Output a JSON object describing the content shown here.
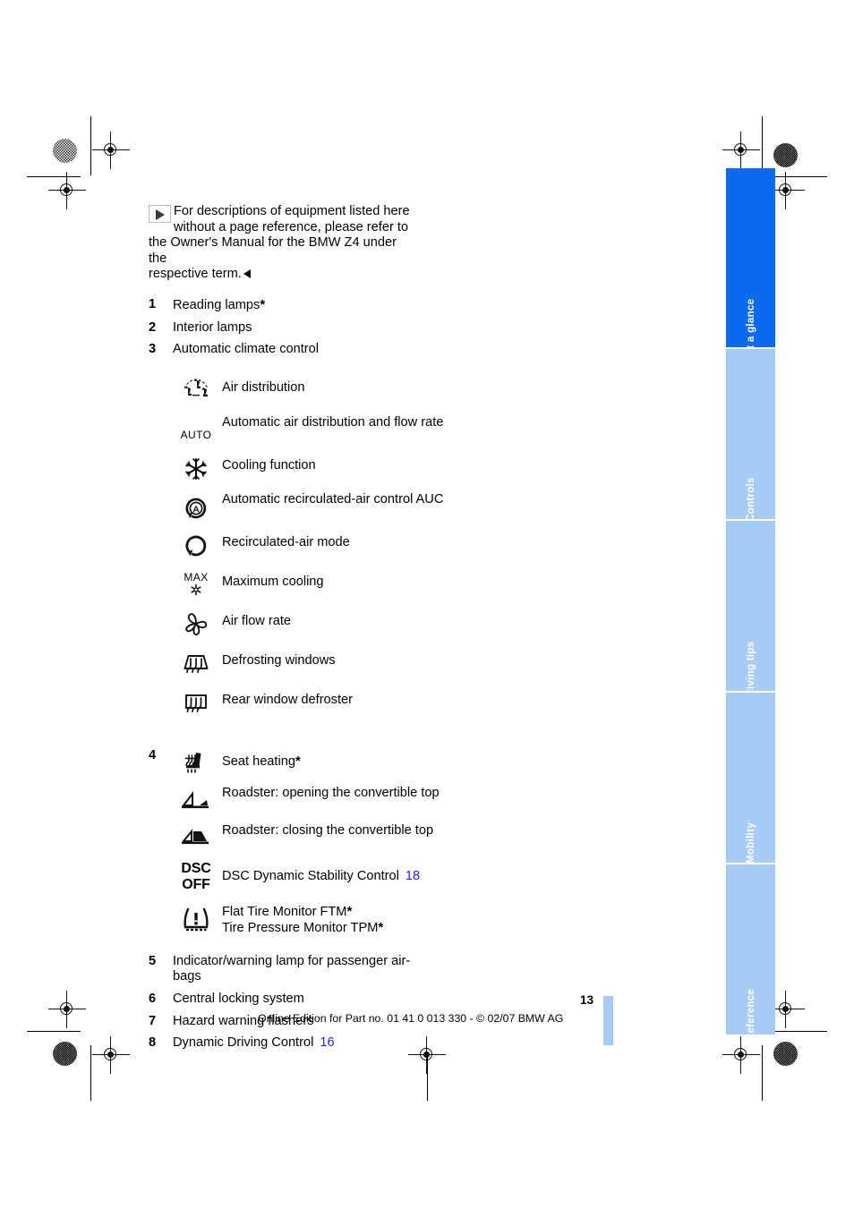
{
  "document": {
    "page_number": "13",
    "footer": "Online Edition for Part no. 01 41 0 013 330 - © 02/07 BMW AG"
  },
  "note": {
    "line1": "For descriptions of equipment listed here",
    "line2": "without a page reference, please refer to",
    "line3": "the Owner's Manual for the BMW Z4 under the",
    "line4": "respective term."
  },
  "items": [
    {
      "num": "1",
      "label": "Reading lamps",
      "star": "*"
    },
    {
      "num": "2",
      "label": "Interior lamps",
      "star": ""
    },
    {
      "num": "3",
      "label": "Automatic climate control",
      "star": ""
    }
  ],
  "climate_icons": [
    {
      "icon": "air-distribution-icon",
      "label": "Air distribution"
    },
    {
      "icon": "auto-icon",
      "label": "Automatic air distribution and flow rate"
    },
    {
      "icon": "snowflake-icon",
      "label": "Cooling function"
    },
    {
      "icon": "auc-icon",
      "label": "Automatic recirculated-air control AUC"
    },
    {
      "icon": "recirculation-icon",
      "label": "Recirculated-air mode"
    },
    {
      "icon": "max-cooling-icon",
      "label": "Maximum cooling"
    },
    {
      "icon": "fan-icon",
      "label": "Air flow rate"
    },
    {
      "icon": "windshield-defrost-icon",
      "label": "Defrosting windows"
    },
    {
      "icon": "rear-defrost-icon",
      "label": "Rear window defroster"
    }
  ],
  "item4": {
    "num": "4",
    "rows": [
      {
        "icon": "seat-heating-icon",
        "label": "Seat heating",
        "star": "*",
        "ref": ""
      },
      {
        "icon": "convertible-open-icon",
        "label": "Roadster: opening the convertible top",
        "star": "",
        "ref": ""
      },
      {
        "icon": "convertible-close-icon",
        "label": "Roadster: closing the convertible top",
        "star": "",
        "ref": ""
      },
      {
        "icon": "dsc-off-icon",
        "label": "DSC Dynamic Stability Control",
        "star": "",
        "ref": "18"
      }
    ],
    "tire_row": {
      "icon": "tire-pressure-icon",
      "line1": "Flat Tire Monitor FTM",
      "line1_star": "*",
      "line2": "Tire Pressure Monitor TPM",
      "line2_star": "*"
    }
  },
  "items_tail": [
    {
      "num": "5",
      "label": "Indicator/warning lamp for passenger air-bags",
      "ref": ""
    },
    {
      "num": "6",
      "label": "Central locking system",
      "ref": ""
    },
    {
      "num": "7",
      "label": "Hazard warning flashers",
      "ref": ""
    },
    {
      "num": "8",
      "label": "Dynamic Driving Control",
      "ref": "16"
    }
  ],
  "tabs": [
    {
      "label": "At a glance",
      "active": true
    },
    {
      "label": "Controls",
      "active": false
    },
    {
      "label": "Driving tips",
      "active": false
    },
    {
      "label": "Mobility",
      "active": false
    },
    {
      "label": "Reference",
      "active": false
    }
  ],
  "icon_text": {
    "auto": "AUTO",
    "max": "MAX",
    "auc_letter": "A",
    "dsc": "DSC",
    "off": "OFF",
    "warning": "!"
  },
  "colors": {
    "tab_active": "#0e6aec",
    "tab_inactive": "#a8cbf5",
    "page_ref": "#2222ee"
  }
}
